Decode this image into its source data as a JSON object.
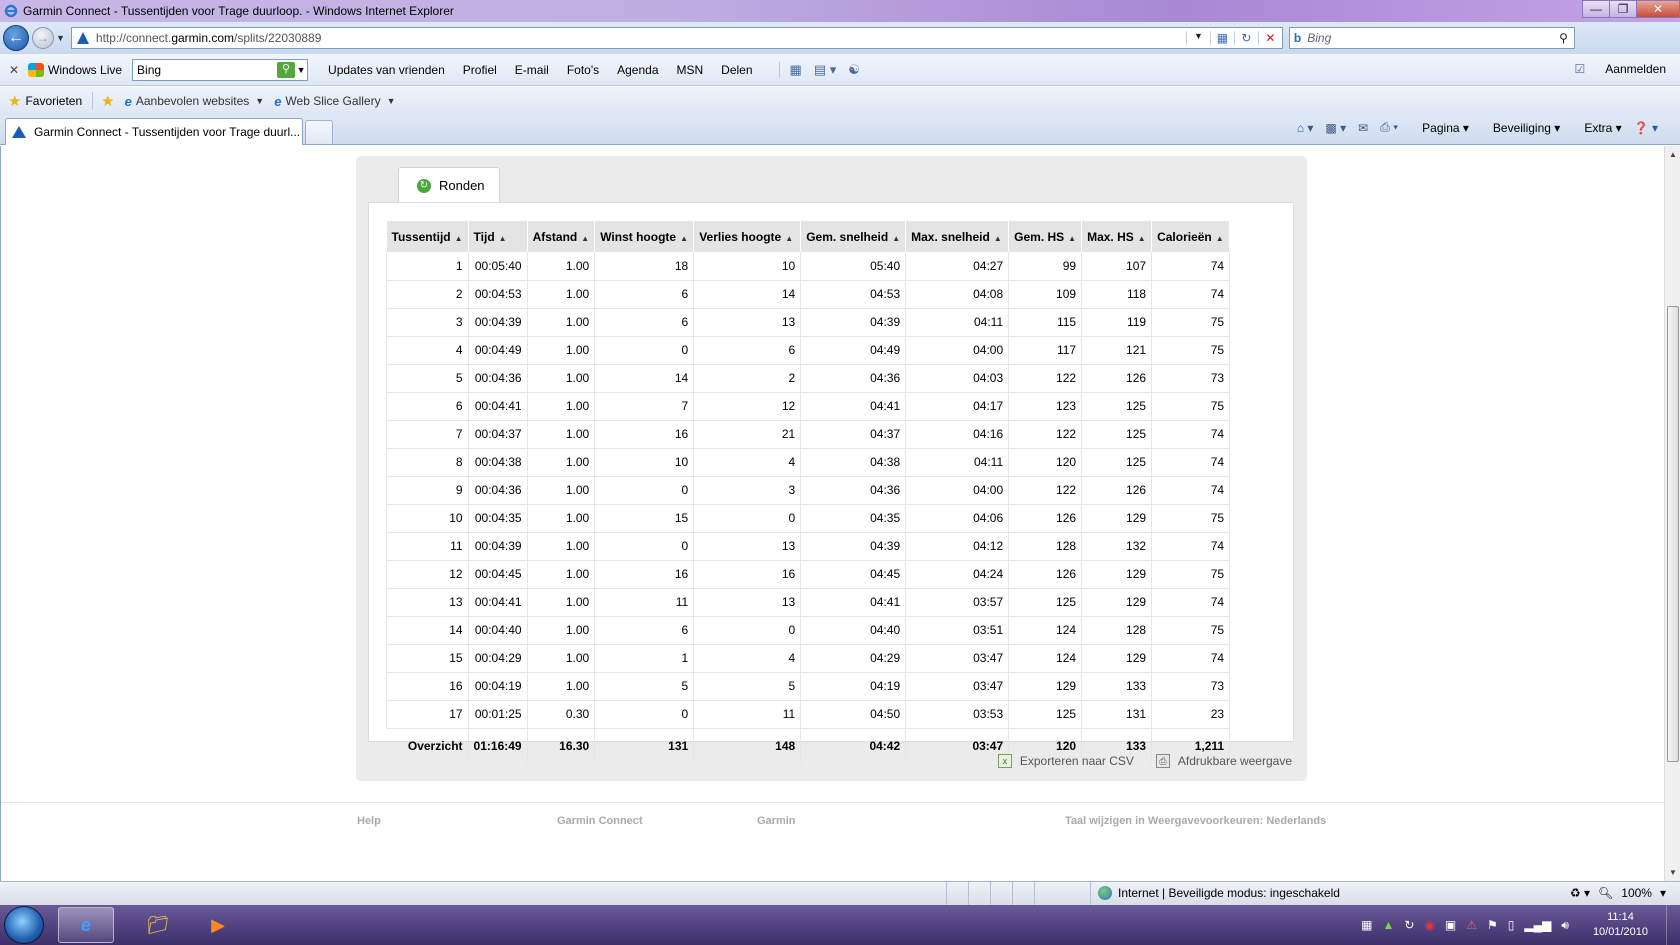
{
  "window": {
    "title": "Garmin Connect - Tussentijden voor Trage duurloop. - Windows Internet Explorer",
    "controls": [
      "0",
      "1",
      "r"
    ]
  },
  "address": {
    "url_prefix": "http://connect.",
    "url_domain": "garmin.com",
    "url_path": "/splits/22030889",
    "search_placeholder": "Bing"
  },
  "windows_live": {
    "brand": "Windows Live",
    "search_value": "Bing",
    "links": [
      "Updates van vrienden",
      "Profiel",
      "E-mail",
      "Foto's",
      "Agenda",
      "MSN",
      "Delen"
    ],
    "signin": "Aanmelden"
  },
  "favorites": {
    "label": "Favorieten",
    "links": [
      "Aanbevolen websites",
      "Web Slice Gallery"
    ]
  },
  "tab": {
    "title": "Garmin Connect - Tussentijden voor Trage duurl..."
  },
  "command_bar": [
    "Pagina",
    "Beveiliging",
    "Extra"
  ],
  "page": {
    "tab_label": "Ronden",
    "columns": [
      "Tussentijd",
      "Tijd",
      "Afstand",
      "Winst hoogte",
      "Verlies hoogte",
      "Gem. snelheid",
      "Max. snelheid",
      "Gem. HS",
      "Max. HS",
      "Calorieën"
    ],
    "rows": [
      [
        "1",
        "00:05:40",
        "1.00",
        "18",
        "10",
        "05:40",
        "04:27",
        "99",
        "107",
        "74"
      ],
      [
        "2",
        "00:04:53",
        "1.00",
        "6",
        "14",
        "04:53",
        "04:08",
        "109",
        "118",
        "74"
      ],
      [
        "3",
        "00:04:39",
        "1.00",
        "6",
        "13",
        "04:39",
        "04:11",
        "115",
        "119",
        "75"
      ],
      [
        "4",
        "00:04:49",
        "1.00",
        "0",
        "6",
        "04:49",
        "04:00",
        "117",
        "121",
        "75"
      ],
      [
        "5",
        "00:04:36",
        "1.00",
        "14",
        "2",
        "04:36",
        "04:03",
        "122",
        "126",
        "73"
      ],
      [
        "6",
        "00:04:41",
        "1.00",
        "7",
        "12",
        "04:41",
        "04:17",
        "123",
        "125",
        "75"
      ],
      [
        "7",
        "00:04:37",
        "1.00",
        "16",
        "21",
        "04:37",
        "04:16",
        "122",
        "125",
        "74"
      ],
      [
        "8",
        "00:04:38",
        "1.00",
        "10",
        "4",
        "04:38",
        "04:11",
        "120",
        "125",
        "74"
      ],
      [
        "9",
        "00:04:36",
        "1.00",
        "0",
        "3",
        "04:36",
        "04:00",
        "122",
        "126",
        "74"
      ],
      [
        "10",
        "00:04:35",
        "1.00",
        "15",
        "0",
        "04:35",
        "04:06",
        "126",
        "129",
        "75"
      ],
      [
        "11",
        "00:04:39",
        "1.00",
        "0",
        "13",
        "04:39",
        "04:12",
        "128",
        "132",
        "74"
      ],
      [
        "12",
        "00:04:45",
        "1.00",
        "16",
        "16",
        "04:45",
        "04:24",
        "126",
        "129",
        "75"
      ],
      [
        "13",
        "00:04:41",
        "1.00",
        "11",
        "13",
        "04:41",
        "03:57",
        "125",
        "129",
        "74"
      ],
      [
        "14",
        "00:04:40",
        "1.00",
        "6",
        "0",
        "04:40",
        "03:51",
        "124",
        "128",
        "75"
      ],
      [
        "15",
        "00:04:29",
        "1.00",
        "1",
        "4",
        "04:29",
        "03:47",
        "124",
        "129",
        "74"
      ],
      [
        "16",
        "00:04:19",
        "1.00",
        "5",
        "5",
        "04:19",
        "03:47",
        "129",
        "133",
        "73"
      ],
      [
        "17",
        "00:01:25",
        "0.30",
        "0",
        "11",
        "04:50",
        "03:53",
        "125",
        "131",
        "23"
      ]
    ],
    "summary": [
      "Overzicht",
      "01:16:49",
      "16.30",
      "131",
      "148",
      "04:42",
      "03:47",
      "120",
      "133",
      "1,211"
    ],
    "export_csv": "Exporteren naar CSV",
    "printable": "Afdrukbare weergave",
    "footer_links": [
      "Help",
      "Garmin Connect",
      "Garmin",
      "Taal wijzigen in Weergavevoorkeuren: Nederlands"
    ]
  },
  "status": {
    "zone": "Internet | Beveiligde modus: ingeschakeld",
    "zoom": "100%"
  },
  "taskbar": {
    "time": "11:14",
    "date": "10/01/2010"
  }
}
